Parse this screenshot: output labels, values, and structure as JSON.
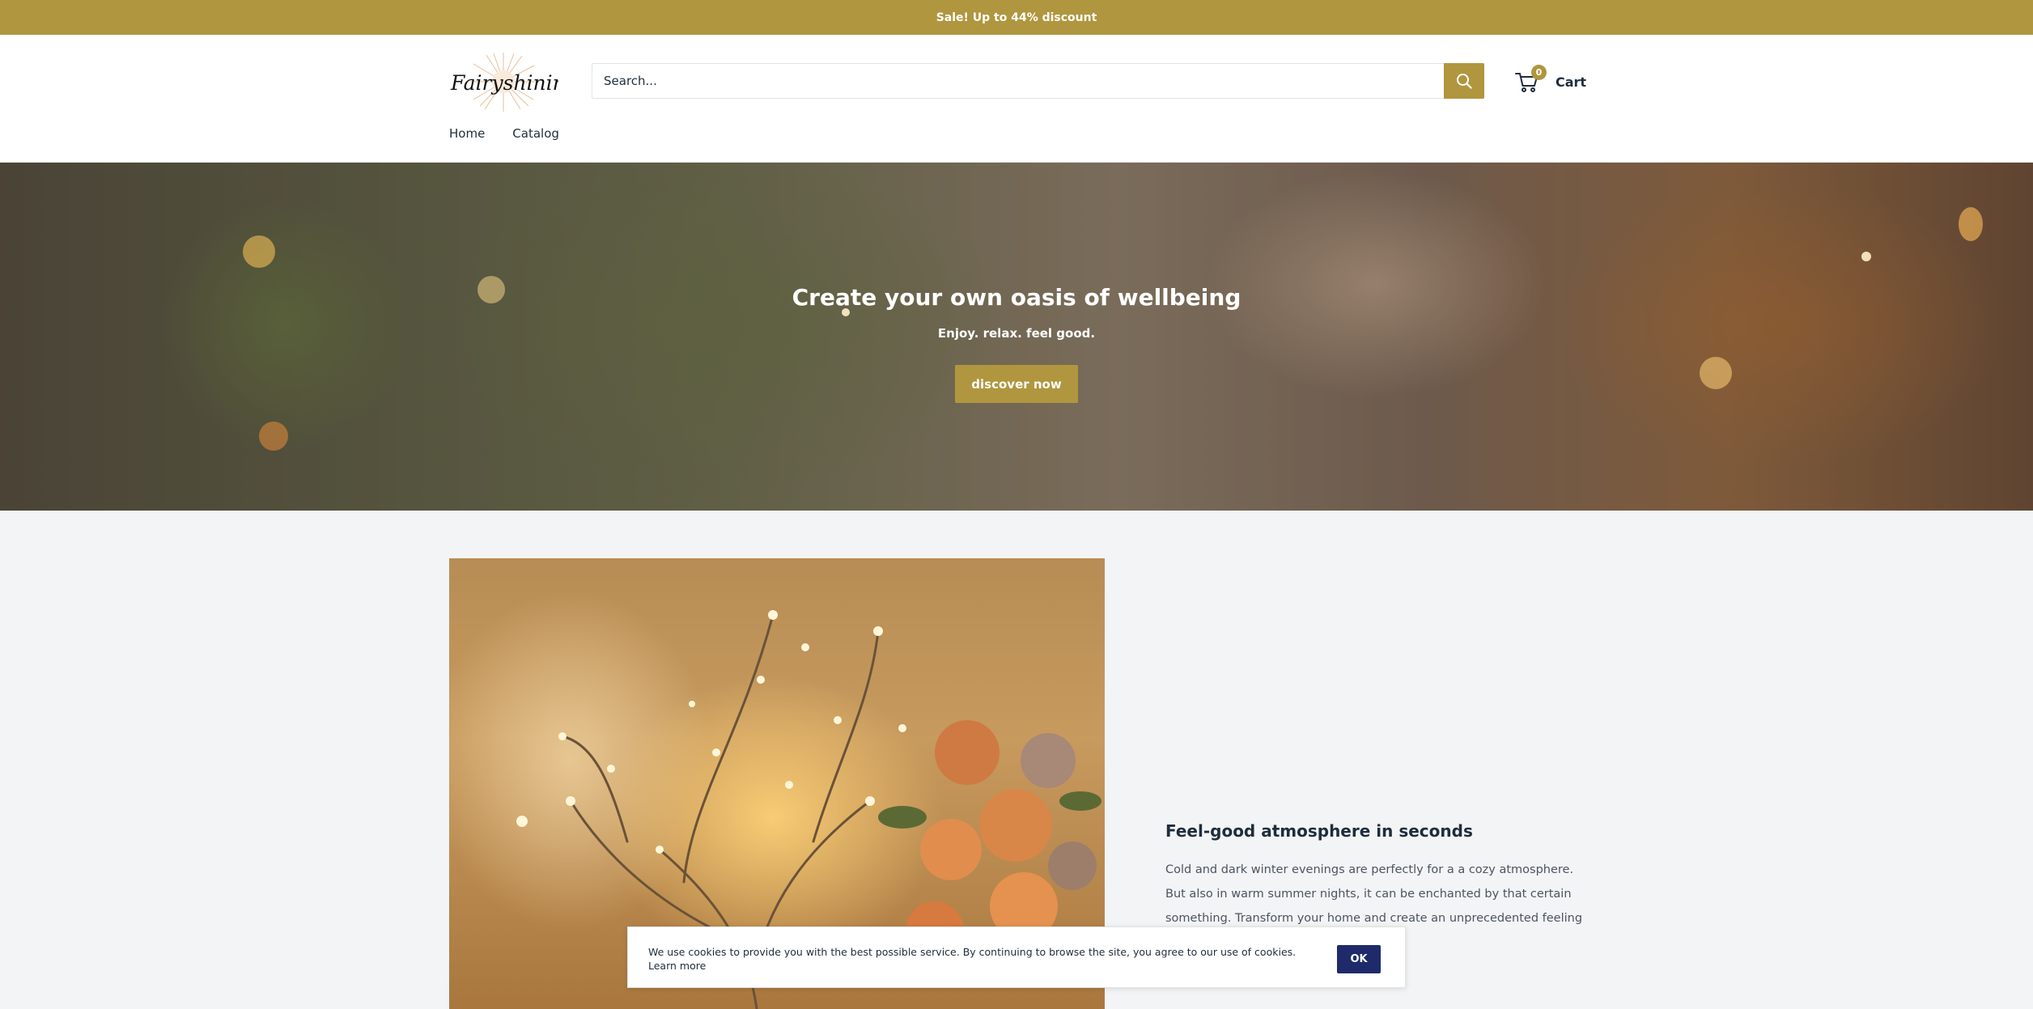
{
  "announcement": {
    "text": "Sale! Up to 44% discount"
  },
  "header": {
    "logo_text": "Fairyshining",
    "search": {
      "placeholder": "Search...",
      "value": ""
    },
    "cart": {
      "label": "Cart",
      "count": "0"
    },
    "nav": [
      {
        "label": "Home"
      },
      {
        "label": "Catalog"
      }
    ]
  },
  "hero": {
    "title": "Create your own oasis of wellbeing",
    "subtitle": "Enjoy. relax. feel good.",
    "button_label": "discover now"
  },
  "feature": {
    "title": "Feel-good atmosphere in seconds",
    "text": "Cold and dark winter evenings are perfectly for a a cozy atmosphere. But also in warm summer nights, it can be enchanted by that certain something. Transform your home and create an unprecedented feeling of"
  },
  "cookie": {
    "text": "We use cookies to provide you with the best possible service. By continuing to browse the site, you agree to our use of cookies. Learn more",
    "button_label": "OK"
  },
  "colors": {
    "accent": "#b0963e",
    "cookie_button": "#1f2a6b",
    "text": "#1e2d3d"
  },
  "icons": {
    "search": "search-icon",
    "cart": "cart-icon"
  }
}
